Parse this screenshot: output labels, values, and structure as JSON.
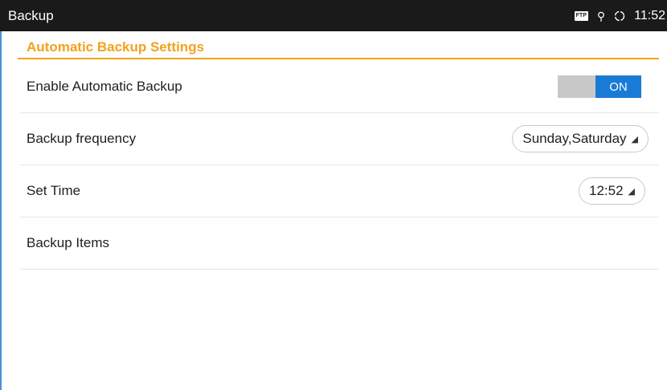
{
  "status_bar": {
    "title": "Backup",
    "ftp_label": "FTP",
    "time": "11:52"
  },
  "section": {
    "header": "Automatic Backup Settings"
  },
  "rows": {
    "enable": {
      "label": "Enable Automatic Backup",
      "toggle_state": "ON"
    },
    "frequency": {
      "label": "Backup frequency",
      "value": "Sunday,Saturday"
    },
    "time": {
      "label": "Set Time",
      "value": "12:52"
    },
    "items": {
      "label": "Backup Items"
    }
  },
  "colors": {
    "accent": "#f3a21c",
    "toggle_on": "#1a7bd6",
    "status_bar_bg": "#1a1a1a"
  },
  "icons": {
    "usb": "usb-icon",
    "sync": "sync-icon",
    "ftp": "ftp-icon",
    "dropdown_caret": "caret-down-icon"
  }
}
